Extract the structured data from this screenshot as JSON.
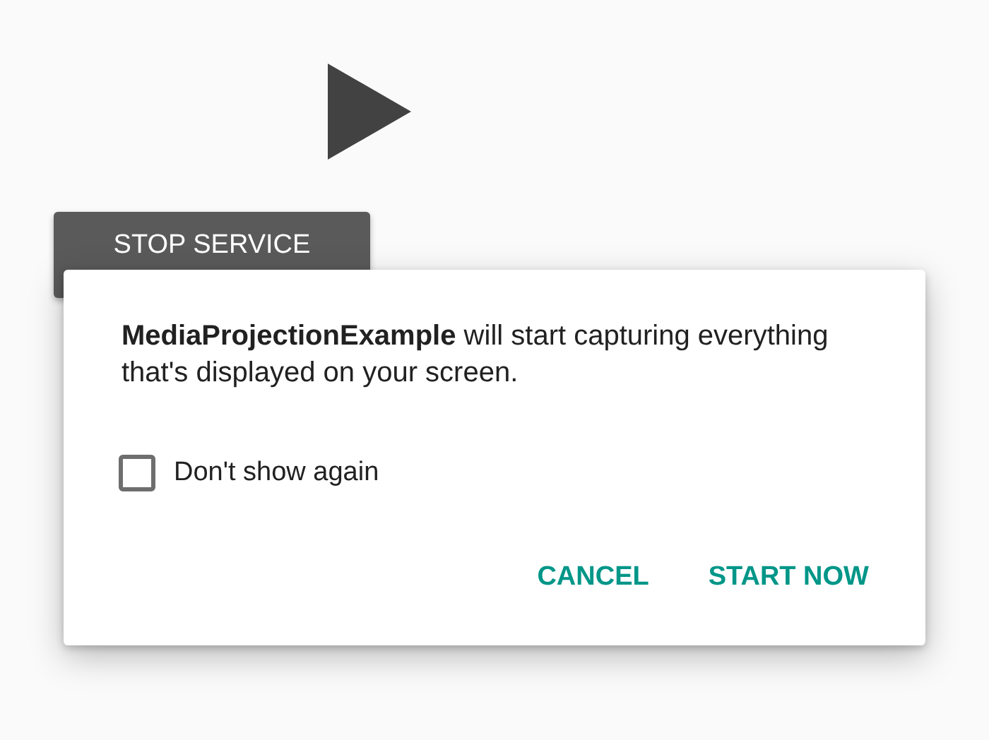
{
  "service_button": {
    "label": "STOP SERVICE"
  },
  "dialog": {
    "message": "**MediaProjectionExample** will start capturing everything that's displayed on your screen.",
    "checkbox": {
      "label": "Don't show again",
      "checked": false
    },
    "actions": [
      "CANCEL",
      "START NOW"
    ]
  }
}
